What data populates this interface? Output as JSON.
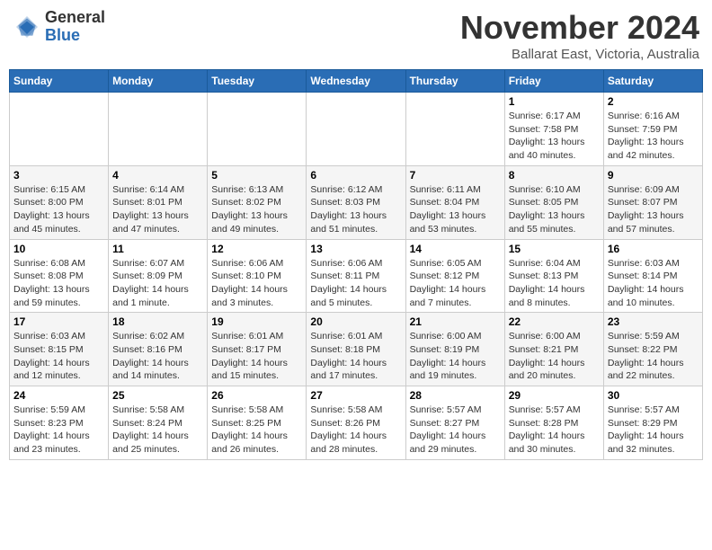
{
  "header": {
    "logo_general": "General",
    "logo_blue": "Blue",
    "month_title": "November 2024",
    "location": "Ballarat East, Victoria, Australia"
  },
  "calendar": {
    "days_of_week": [
      "Sunday",
      "Monday",
      "Tuesday",
      "Wednesday",
      "Thursday",
      "Friday",
      "Saturday"
    ],
    "weeks": [
      [
        {
          "day": "",
          "info": ""
        },
        {
          "day": "",
          "info": ""
        },
        {
          "day": "",
          "info": ""
        },
        {
          "day": "",
          "info": ""
        },
        {
          "day": "",
          "info": ""
        },
        {
          "day": "1",
          "info": "Sunrise: 6:17 AM\nSunset: 7:58 PM\nDaylight: 13 hours\nand 40 minutes."
        },
        {
          "day": "2",
          "info": "Sunrise: 6:16 AM\nSunset: 7:59 PM\nDaylight: 13 hours\nand 42 minutes."
        }
      ],
      [
        {
          "day": "3",
          "info": "Sunrise: 6:15 AM\nSunset: 8:00 PM\nDaylight: 13 hours\nand 45 minutes."
        },
        {
          "day": "4",
          "info": "Sunrise: 6:14 AM\nSunset: 8:01 PM\nDaylight: 13 hours\nand 47 minutes."
        },
        {
          "day": "5",
          "info": "Sunrise: 6:13 AM\nSunset: 8:02 PM\nDaylight: 13 hours\nand 49 minutes."
        },
        {
          "day": "6",
          "info": "Sunrise: 6:12 AM\nSunset: 8:03 PM\nDaylight: 13 hours\nand 51 minutes."
        },
        {
          "day": "7",
          "info": "Sunrise: 6:11 AM\nSunset: 8:04 PM\nDaylight: 13 hours\nand 53 minutes."
        },
        {
          "day": "8",
          "info": "Sunrise: 6:10 AM\nSunset: 8:05 PM\nDaylight: 13 hours\nand 55 minutes."
        },
        {
          "day": "9",
          "info": "Sunrise: 6:09 AM\nSunset: 8:07 PM\nDaylight: 13 hours\nand 57 minutes."
        }
      ],
      [
        {
          "day": "10",
          "info": "Sunrise: 6:08 AM\nSunset: 8:08 PM\nDaylight: 13 hours\nand 59 minutes."
        },
        {
          "day": "11",
          "info": "Sunrise: 6:07 AM\nSunset: 8:09 PM\nDaylight: 14 hours\nand 1 minute."
        },
        {
          "day": "12",
          "info": "Sunrise: 6:06 AM\nSunset: 8:10 PM\nDaylight: 14 hours\nand 3 minutes."
        },
        {
          "day": "13",
          "info": "Sunrise: 6:06 AM\nSunset: 8:11 PM\nDaylight: 14 hours\nand 5 minutes."
        },
        {
          "day": "14",
          "info": "Sunrise: 6:05 AM\nSunset: 8:12 PM\nDaylight: 14 hours\nand 7 minutes."
        },
        {
          "day": "15",
          "info": "Sunrise: 6:04 AM\nSunset: 8:13 PM\nDaylight: 14 hours\nand 8 minutes."
        },
        {
          "day": "16",
          "info": "Sunrise: 6:03 AM\nSunset: 8:14 PM\nDaylight: 14 hours\nand 10 minutes."
        }
      ],
      [
        {
          "day": "17",
          "info": "Sunrise: 6:03 AM\nSunset: 8:15 PM\nDaylight: 14 hours\nand 12 minutes."
        },
        {
          "day": "18",
          "info": "Sunrise: 6:02 AM\nSunset: 8:16 PM\nDaylight: 14 hours\nand 14 minutes."
        },
        {
          "day": "19",
          "info": "Sunrise: 6:01 AM\nSunset: 8:17 PM\nDaylight: 14 hours\nand 15 minutes."
        },
        {
          "day": "20",
          "info": "Sunrise: 6:01 AM\nSunset: 8:18 PM\nDaylight: 14 hours\nand 17 minutes."
        },
        {
          "day": "21",
          "info": "Sunrise: 6:00 AM\nSunset: 8:19 PM\nDaylight: 14 hours\nand 19 minutes."
        },
        {
          "day": "22",
          "info": "Sunrise: 6:00 AM\nSunset: 8:21 PM\nDaylight: 14 hours\nand 20 minutes."
        },
        {
          "day": "23",
          "info": "Sunrise: 5:59 AM\nSunset: 8:22 PM\nDaylight: 14 hours\nand 22 minutes."
        }
      ],
      [
        {
          "day": "24",
          "info": "Sunrise: 5:59 AM\nSunset: 8:23 PM\nDaylight: 14 hours\nand 23 minutes."
        },
        {
          "day": "25",
          "info": "Sunrise: 5:58 AM\nSunset: 8:24 PM\nDaylight: 14 hours\nand 25 minutes."
        },
        {
          "day": "26",
          "info": "Sunrise: 5:58 AM\nSunset: 8:25 PM\nDaylight: 14 hours\nand 26 minutes."
        },
        {
          "day": "27",
          "info": "Sunrise: 5:58 AM\nSunset: 8:26 PM\nDaylight: 14 hours\nand 28 minutes."
        },
        {
          "day": "28",
          "info": "Sunrise: 5:57 AM\nSunset: 8:27 PM\nDaylight: 14 hours\nand 29 minutes."
        },
        {
          "day": "29",
          "info": "Sunrise: 5:57 AM\nSunset: 8:28 PM\nDaylight: 14 hours\nand 30 minutes."
        },
        {
          "day": "30",
          "info": "Sunrise: 5:57 AM\nSunset: 8:29 PM\nDaylight: 14 hours\nand 32 minutes."
        }
      ]
    ]
  }
}
